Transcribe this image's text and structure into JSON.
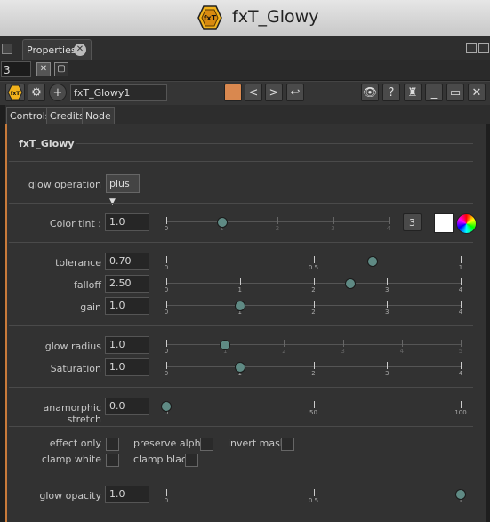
{
  "window": {
    "title": "fxT_Glowy",
    "logo_text": "fxT"
  },
  "panel": {
    "tab_label": "Properties",
    "max_nodes": "3"
  },
  "node": {
    "name": "fxT_Glowy1",
    "color": "#d9884f"
  },
  "tabs": [
    "Controls",
    "Credits",
    "Node"
  ],
  "section_title": "fxT_Glowy",
  "glow_operation": {
    "label": "glow operation",
    "value": "plus"
  },
  "color_tint": {
    "label": "Color tint :",
    "value": "1.0",
    "channels": "3",
    "swatch": "#ffffff",
    "ticks": [
      "0",
      "1",
      "2",
      "3",
      "4"
    ],
    "fraction": 0.25
  },
  "tolerance": {
    "label": "tolerance",
    "value": "0.70",
    "ticks": [
      "0",
      "0.5",
      "1"
    ],
    "fraction": 0.7
  },
  "falloff": {
    "label": "falloff",
    "value": "2.50",
    "ticks": [
      "0",
      "1",
      "2",
      "3",
      "4"
    ],
    "fraction": 0.625
  },
  "gain": {
    "label": "gain",
    "value": "1.0",
    "ticks": [
      "0",
      "1",
      "2",
      "3",
      "4"
    ],
    "fraction": 0.25
  },
  "glow_radius": {
    "label": "glow radius",
    "value": "1.0",
    "ticks": [
      "0",
      "1",
      "2",
      "3",
      "4",
      "5"
    ],
    "fraction": 0.2
  },
  "saturation": {
    "label": "Saturation",
    "value": "1.0",
    "ticks": [
      "0",
      "1",
      "2",
      "3",
      "4"
    ],
    "fraction": 0.25
  },
  "anamorphic": {
    "label": "anamorphic stretch",
    "value": "0.0",
    "ticks": [
      "0",
      "50",
      "100"
    ],
    "fraction": 0.0
  },
  "checks": {
    "effect_only": "effect only",
    "preserve_alpha": "preserve alpha",
    "invert_mask": "invert mask",
    "clamp_white": "clamp white",
    "clamp_black": "clamp black"
  },
  "glow_opacity": {
    "label": "glow opacity",
    "value": "1.0",
    "ticks": [
      "0",
      "0.5",
      "1"
    ],
    "fraction": 1.0
  },
  "colors": {
    "accent_orange": "#c87a3a",
    "knob": "#5f8a84",
    "logo_yellow": "#f2b21b"
  }
}
